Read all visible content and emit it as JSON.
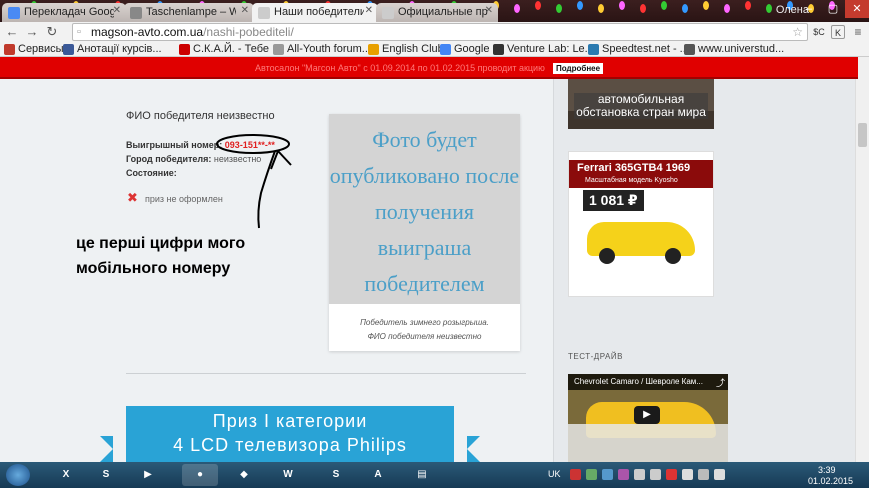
{
  "browser": {
    "tabs": [
      {
        "label": "Перекладач Google",
        "color": "#4a8af4"
      },
      {
        "label": "Taschenlampe – Wi",
        "color": "#888888"
      },
      {
        "label": "Наши победители",
        "color": "#cccccc"
      },
      {
        "label": "Официальные прав",
        "color": "#cccccc"
      }
    ],
    "user_name": "Олена",
    "url_host": "magson-avto.com.ua",
    "url_path": "/nashi-pobediteli/",
    "extensions": [
      "$C",
      "K"
    ]
  },
  "bookmarks": [
    {
      "label": "Сервисы",
      "color": "#c0392b"
    },
    {
      "label": "Анотації курсів...",
      "color": "#3b5998"
    },
    {
      "label": "С.К.А.Й. - Тебе ...",
      "color": "#cc0000"
    },
    {
      "label": "All-Youth forum...",
      "color": "#999999"
    },
    {
      "label": "English Club",
      "color": "#e8a000"
    },
    {
      "label": "Google",
      "color": "#4285f4"
    },
    {
      "label": "Venture Lab: Le...",
      "color": "#333333"
    },
    {
      "label": "Speedtest.net - ...",
      "color": "#2a7ab0"
    },
    {
      "label": "www.universtud...",
      "color": "#555555"
    }
  ],
  "banner": {
    "text": "Автосалон \"Магсон Авто\" с 01.09.2014 по 01.02.2015 проводит акцию",
    "button": "Подробнее"
  },
  "winner": {
    "title": "ФИО победителя неизвестно",
    "number_label": "Выигрышный номер:",
    "number_value": "093-151**-**",
    "city_label": "Город победителя:",
    "city_value": "неизвестно",
    "state_label": "Состояние:",
    "status": "приз не оформлен"
  },
  "annotation": "це перші цифри мого мобільного номеру",
  "photo": {
    "text": "Фото будет опубликовано после получения выиграша победителем",
    "caption_1": "Победитель зимнего розыгрыша.",
    "caption_2": "ФИО победителя неизвестно"
  },
  "prize": {
    "line_1": "Приз I категории",
    "line_2": "4 LCD телевизора Philips"
  },
  "sidebar": {
    "ad1_text": "автомобильная обстановка стран мира",
    "ad2_title": "Ferrari 365GTB4 1969",
    "ad2_sub": "Масштабная модель Kyosho",
    "ad2_price": "1 081 ₽",
    "test_drive_title": "ТЕСТ-ДРАЙВ",
    "video_title": "Chevrolet Camaro / Шевроле Кам..."
  },
  "taskbar": {
    "apps": [
      {
        "label": "X",
        "color": "#1d7b3a"
      },
      {
        "label": "S",
        "color": "#2a5fa8"
      },
      {
        "label": "▶",
        "color": "#e0641e"
      },
      {
        "label": "●",
        "color": "#ea4335"
      },
      {
        "label": "◆",
        "color": "#8c3"
      },
      {
        "label": "W",
        "color": "#2b579a"
      },
      {
        "label": "S",
        "color": "#00aff0"
      },
      {
        "label": "A",
        "color": "#d2261d"
      },
      {
        "label": "▤",
        "color": "#e8c35a"
      }
    ],
    "lang": "UK",
    "time": "3:39",
    "date": "01.02.2015"
  }
}
